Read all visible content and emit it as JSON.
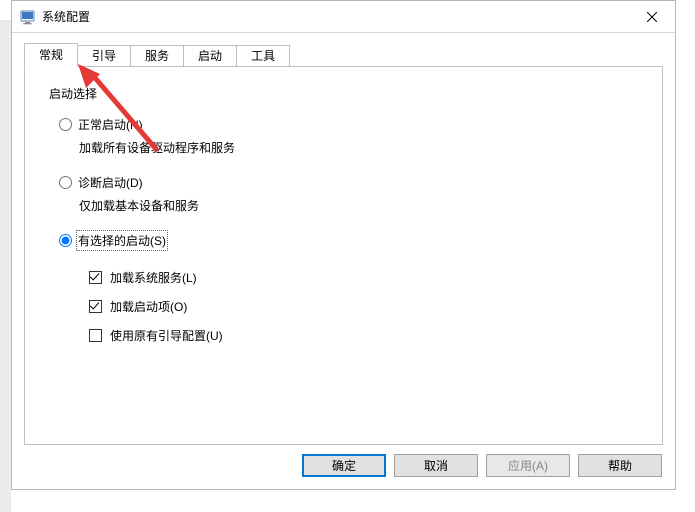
{
  "title": "系统配置",
  "tabs": [
    {
      "label": "常规",
      "active": true
    },
    {
      "label": "引导",
      "active": false
    },
    {
      "label": "服务",
      "active": false
    },
    {
      "label": "启动",
      "active": false
    },
    {
      "label": "工具",
      "active": false
    }
  ],
  "group_label": "启动选择",
  "radios": [
    {
      "label": "正常启动(N)",
      "desc": "加载所有设备驱动程序和服务",
      "checked": false
    },
    {
      "label": "诊断启动(D)",
      "desc": "仅加载基本设备和服务",
      "checked": false
    },
    {
      "label": "有选择的启动(S)",
      "desc": "",
      "checked": true
    }
  ],
  "checkboxes": [
    {
      "label": "加载系统服务(L)",
      "checked": true
    },
    {
      "label": "加载启动项(O)",
      "checked": true
    },
    {
      "label": "使用原有引导配置(U)",
      "checked": false
    }
  ],
  "buttons": {
    "ok": "确定",
    "cancel": "取消",
    "apply": "应用(A)",
    "help": "帮助"
  }
}
